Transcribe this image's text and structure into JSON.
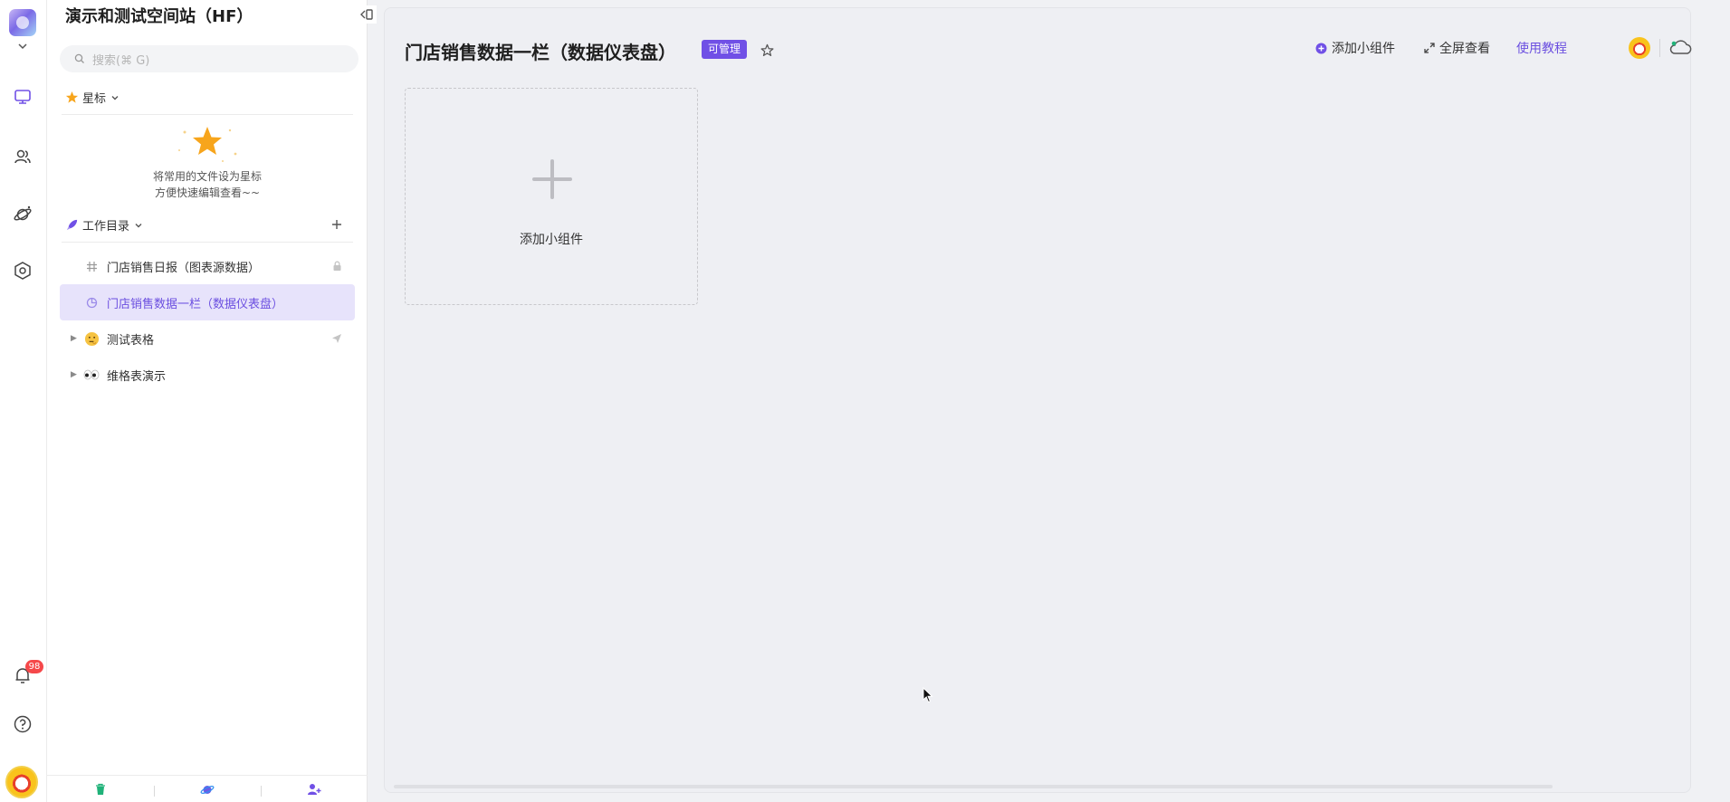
{
  "rail": {
    "notifications_count": "98"
  },
  "sidebar": {
    "space_title": "演示和测试空间站（HF）",
    "search_placeholder": "搜索(⌘ G)",
    "starred": {
      "label": "星标",
      "empty_line1": "将常用的文件设为星标",
      "empty_line2": "方便快速编辑查看~~"
    },
    "catalog": {
      "label": "工作目录"
    },
    "items": [
      {
        "label": "门店销售日报（图表源数据）"
      },
      {
        "label": "门店销售数据一栏（数据仪表盘）"
      },
      {
        "label": "测试表格"
      },
      {
        "label": "维格表演示"
      }
    ]
  },
  "main": {
    "title": "门店销售数据一栏（数据仪表盘）",
    "permission_badge": "可管理",
    "toolbar": {
      "add_widget": "添加小组件",
      "fullscreen": "全屏查看",
      "tutorial": "使用教程"
    },
    "widget_placeholder_label": "添加小组件"
  },
  "colors": {
    "accent": "#7050e6",
    "selected_bg": "#e7e3fb",
    "badge_red": "#f5484a"
  }
}
